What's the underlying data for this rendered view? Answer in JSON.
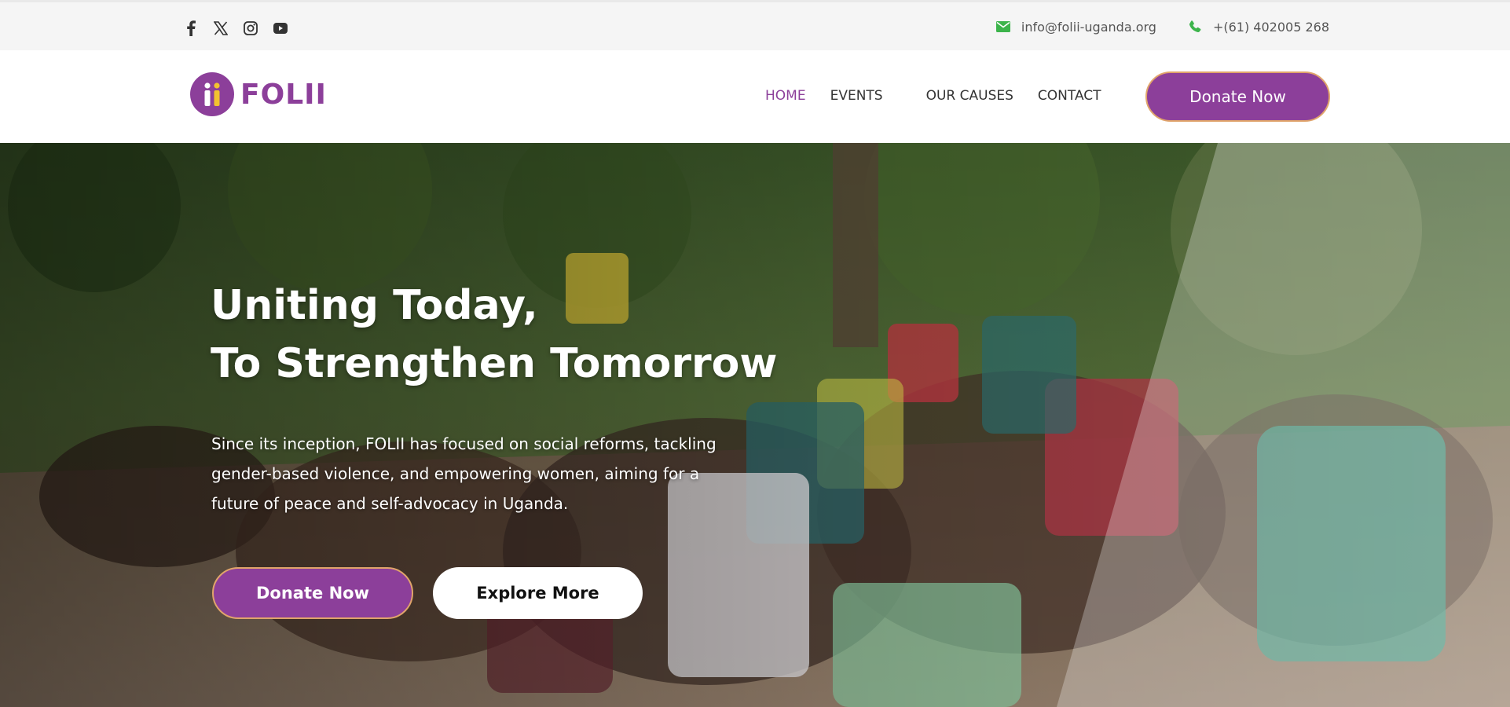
{
  "topbar": {
    "social_icons": [
      "facebook-icon",
      "x-icon",
      "instagram-icon",
      "youtube-icon"
    ],
    "email": "info@folii-uganda.org",
    "phone": "+(61) 402005 268"
  },
  "header": {
    "logo_text": "FOLII",
    "nav": [
      "HOME",
      "EVENTS",
      "OUR CAUSES",
      "CONTACT"
    ],
    "active_nav": "HOME",
    "donate_label": "Donate Now"
  },
  "hero": {
    "title_line1": "Uniting Today,",
    "title_line2": "To Strengthen Tomorrow",
    "description": "Since its inception, FOLII has focused on social reforms, tackling gender-based violence, and empowering women, aiming for a future of peace and self-advocacy in Uganda.",
    "primary_button": "Donate Now",
    "secondary_button": "Explore More"
  },
  "colors": {
    "brand_purple": "#8c3f9a",
    "button_border": "#e0a46b",
    "icon_green": "#3cb44b"
  }
}
